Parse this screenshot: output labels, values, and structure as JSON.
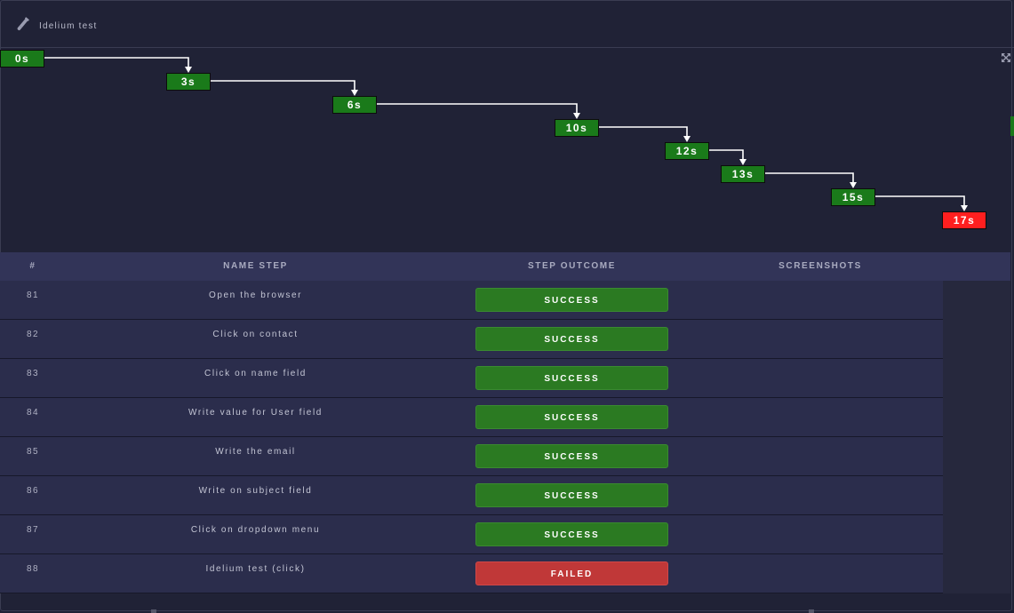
{
  "header": {
    "title": "Idelium test",
    "icon": "flask-icon"
  },
  "timeline": {
    "nodes": [
      {
        "label": "0s",
        "status": "success"
      },
      {
        "label": "3s",
        "status": "success"
      },
      {
        "label": "6s",
        "status": "success"
      },
      {
        "label": "10s",
        "status": "success"
      },
      {
        "label": "12s",
        "status": "success"
      },
      {
        "label": "13s",
        "status": "success"
      },
      {
        "label": "15s",
        "status": "success"
      },
      {
        "label": "17s",
        "status": "failed"
      }
    ]
  },
  "table": {
    "headers": {
      "num": "#",
      "name": "NAME STEP",
      "outcome": "STEP OUTCOME",
      "screenshots": "SCREENSHOTS"
    },
    "rows": [
      {
        "num": "81",
        "name": "Open the browser",
        "outcome": "SUCCESS",
        "status": "success"
      },
      {
        "num": "82",
        "name": "Click on contact",
        "outcome": "SUCCESS",
        "status": "success"
      },
      {
        "num": "83",
        "name": "Click on name field",
        "outcome": "SUCCESS",
        "status": "success"
      },
      {
        "num": "84",
        "name": "Write value for User field",
        "outcome": "SUCCESS",
        "status": "success"
      },
      {
        "num": "85",
        "name": "Write the email",
        "outcome": "SUCCESS",
        "status": "success"
      },
      {
        "num": "86",
        "name": "Write on subject field",
        "outcome": "SUCCESS",
        "status": "success"
      },
      {
        "num": "87",
        "name": "Click on dropdown menu",
        "outcome": "SUCCESS",
        "status": "success"
      },
      {
        "num": "88",
        "name": "Idelium test (click)",
        "outcome": "FAILED",
        "status": "failed"
      }
    ]
  },
  "colors": {
    "success": "#2b7a22",
    "failed": "#c03838",
    "timeline_success": "#1a7a1a",
    "timeline_failed": "#ff1f1f"
  }
}
